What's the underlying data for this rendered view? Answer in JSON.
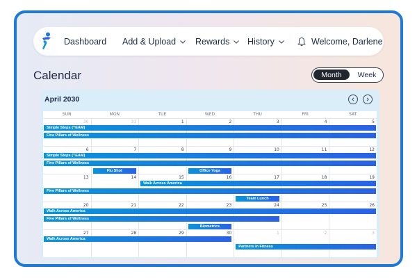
{
  "nav": {
    "items": [
      {
        "label": "Dashboard",
        "has_chevron": false
      },
      {
        "label": "Add & Upload",
        "has_chevron": true
      },
      {
        "label": "Rewards",
        "has_chevron": true
      },
      {
        "label": "History",
        "has_chevron": true
      }
    ],
    "welcome": "Welcome, Darlene"
  },
  "page": {
    "title": "Calendar"
  },
  "view_toggle": {
    "month": "Month",
    "week": "Week",
    "selected": "Month"
  },
  "calendar": {
    "month_label": "April 2030",
    "weekdays": [
      "SUN",
      "MON",
      "TUE",
      "WED",
      "THU",
      "FRI",
      "SAT"
    ],
    "weeks": [
      {
        "days": [
          {
            "n": "30",
            "other": true
          },
          {
            "n": "31",
            "other": true
          },
          {
            "n": "1"
          },
          {
            "n": "2"
          },
          {
            "n": "3"
          },
          {
            "n": "4"
          },
          {
            "n": "5"
          }
        ],
        "events": [
          {
            "label": "Simple Steps (TEAM)",
            "start": 0,
            "span": 7,
            "lane": 0
          },
          {
            "label": "Five Pillars of Wellness",
            "start": 0,
            "span": 7,
            "lane": 1
          }
        ]
      },
      {
        "days": [
          {
            "n": "6"
          },
          {
            "n": "7"
          },
          {
            "n": "8"
          },
          {
            "n": "9"
          },
          {
            "n": "10"
          },
          {
            "n": "11"
          },
          {
            "n": "12"
          }
        ],
        "events": [
          {
            "label": "Simple Steps (TEAM)",
            "start": 0,
            "span": 7,
            "lane": 0
          },
          {
            "label": "Five Pillars of Wellness",
            "start": 0,
            "span": 7,
            "lane": 1
          },
          {
            "label": "Flu Shot",
            "start": 1,
            "span": 1,
            "lane": 2,
            "center": true
          },
          {
            "label": "Office Yoga",
            "start": 3,
            "span": 1,
            "lane": 2,
            "center": true
          }
        ]
      },
      {
        "days": [
          {
            "n": "13"
          },
          {
            "n": "14"
          },
          {
            "n": "15"
          },
          {
            "n": "16"
          },
          {
            "n": "17"
          },
          {
            "n": "18"
          },
          {
            "n": "19"
          }
        ],
        "events": [
          {
            "label": "Walk Across America",
            "start": 2,
            "span": 5,
            "lane": 0
          },
          {
            "label": "Five Pillars of Wellness",
            "start": 0,
            "span": 7,
            "lane": 1
          },
          {
            "label": "Team Lunch",
            "start": 4,
            "span": 1,
            "lane": 2,
            "center": true
          }
        ]
      },
      {
        "days": [
          {
            "n": "20"
          },
          {
            "n": "21"
          },
          {
            "n": "22"
          },
          {
            "n": "23"
          },
          {
            "n": "24"
          },
          {
            "n": "25"
          },
          {
            "n": "26"
          }
        ],
        "events": [
          {
            "label": "Walk Across America",
            "start": 0,
            "span": 7,
            "lane": 0
          },
          {
            "label": "Five Pillars of Wellness",
            "start": 0,
            "span": 5,
            "lane": 1
          },
          {
            "label": "Biometrics",
            "start": 3,
            "span": 1,
            "lane": 2,
            "center": true
          }
        ]
      },
      {
        "days": [
          {
            "n": "27"
          },
          {
            "n": "28"
          },
          {
            "n": "29"
          },
          {
            "n": "30"
          },
          {
            "n": "1",
            "other": true
          },
          {
            "n": "2",
            "other": true
          },
          {
            "n": "3",
            "other": true
          }
        ],
        "events": [
          {
            "label": "Walk Across America",
            "start": 0,
            "span": 4,
            "lane": 0
          },
          {
            "label": "Partners In Fitness",
            "start": 4,
            "span": 3,
            "lane": 1
          }
        ]
      }
    ]
  },
  "colors": {
    "frame_border": "#1e7ad6",
    "event_start": "#0b94d8",
    "event_end": "#2a62e4",
    "toggle_active": "#23262e",
    "calendar_bg": "#d9eef9"
  },
  "icons": {
    "logo": "running-figure-logo",
    "nav_chevron": "chevron-down-icon",
    "notifications": "bell-icon",
    "prev": "chevron-left-icon",
    "next": "chevron-right-icon"
  }
}
